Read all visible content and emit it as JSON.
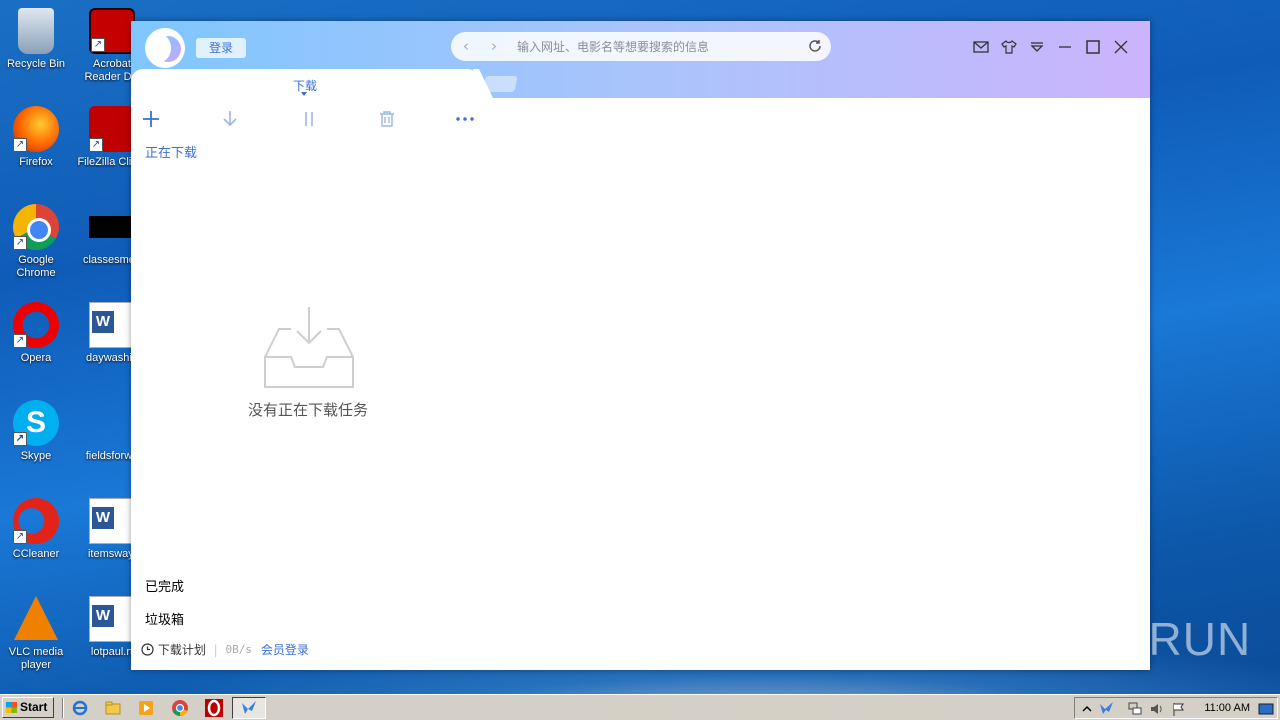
{
  "desktop": {
    "icons": [
      {
        "label": "Recycle Bin"
      },
      {
        "label": "Acrobat Reader DC"
      },
      {
        "label": "Firefox"
      },
      {
        "label": "FileZilla Client"
      },
      {
        "label": "Google Chrome"
      },
      {
        "label": "classesmen"
      },
      {
        "label": "Opera"
      },
      {
        "label": "daywashin"
      },
      {
        "label": "Skype"
      },
      {
        "label": "fieldsforwa"
      },
      {
        "label": "CCleaner"
      },
      {
        "label": "itemsway."
      },
      {
        "label": "VLC media player"
      },
      {
        "label": "lotpaul.rt"
      }
    ]
  },
  "app": {
    "login_label": "登录",
    "search": {
      "placeholder": "输入网址、电影名等想要搜索的信息"
    },
    "tabs": [
      {
        "label": "下载"
      }
    ],
    "toolbar": [
      "add-icon",
      "download-icon",
      "pause-icon",
      "trash-icon",
      "more-icon"
    ],
    "sections": {
      "active": "正在下载",
      "completed": "已完成",
      "trash": "垃圾箱"
    },
    "empty_message": "没有正在下载任务",
    "status": {
      "schedule": "下载计划",
      "speed": "0B/s",
      "vip": "会员登录"
    }
  },
  "watermark": "ANY RUN",
  "taskbar": {
    "start": "Start",
    "clock": "11:00 AM"
  },
  "colors": {
    "accent": "#3d6fd6",
    "titlebar_start": "#7fc6ff",
    "titlebar_end": "#cbb4fb"
  }
}
